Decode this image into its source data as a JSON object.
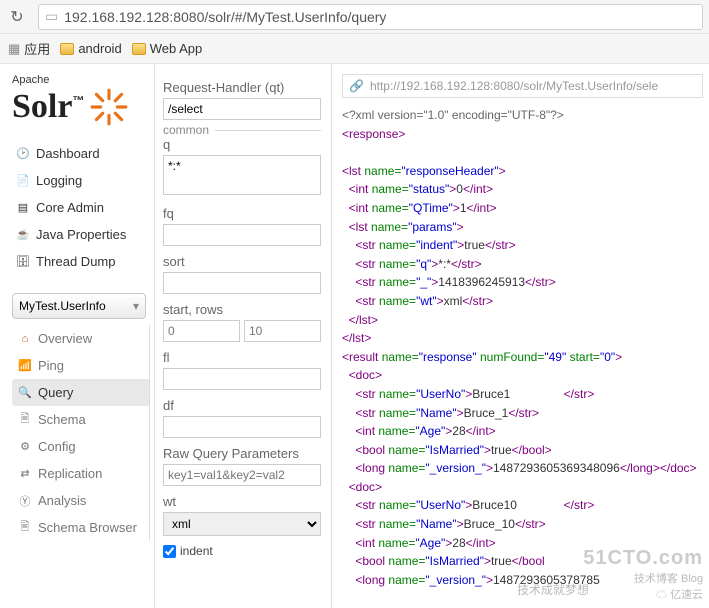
{
  "browser": {
    "url": "192.168.192.128:8080/solr/#/MyTest.UserInfo/query",
    "bookmarks": {
      "app": "应用",
      "android": "android",
      "webapp": "Web App"
    }
  },
  "logo": {
    "apache": "Apache",
    "solr": "Solr ™"
  },
  "nav": {
    "dashboard": "Dashboard",
    "logging": "Logging",
    "coreadmin": "Core Admin",
    "javaprops": "Java Properties",
    "threaddump": "Thread Dump"
  },
  "coreSelect": "MyTest.UserInfo",
  "subnav": {
    "overview": "Overview",
    "ping": "Ping",
    "query": "Query",
    "schema": "Schema",
    "config": "Config",
    "replication": "Replication",
    "analysis": "Analysis",
    "schemabrowser": "Schema Browser"
  },
  "form": {
    "rh_label": "Request-Handler (qt)",
    "rh_value": "/select",
    "common": "common",
    "q_label": "q",
    "q_value": "*:*",
    "fq_label": "fq",
    "sort_label": "sort",
    "start_label": "start, rows",
    "start_value": "0",
    "rows_value": "10",
    "fl_label": "fl",
    "df_label": "df",
    "raw_label": "Raw Query Parameters",
    "raw_ph": "key1=val1&key2=val2",
    "wt_label": "wt",
    "wt_value": "xml",
    "indent_label": "indent"
  },
  "result": {
    "url": "http://192.168.192.128:8080/solr/MyTest.UserInfo/sele",
    "decl": "<?xml version=\"1.0\" encoding=\"UTF-8\"?>",
    "status": "0",
    "qtime": "1",
    "indent": "true",
    "q": "*:*",
    "ts": "1418396245913",
    "wt": "xml",
    "numFound": "49",
    "start": "0",
    "doc1": {
      "userno": "Bruce1",
      "name": "Bruce_1",
      "age": "28",
      "married": "true",
      "version": "1487293605369348096"
    },
    "doc2": {
      "userno": "Bruce10",
      "name": "Bruce_10",
      "age": "28",
      "married": "true",
      "version": "1487293605378785"
    }
  },
  "wm": {
    "site": "51CTO.com",
    "tag": "技术博客   Blog",
    "yun": "亿速云",
    "sj": "技术成就梦想"
  }
}
